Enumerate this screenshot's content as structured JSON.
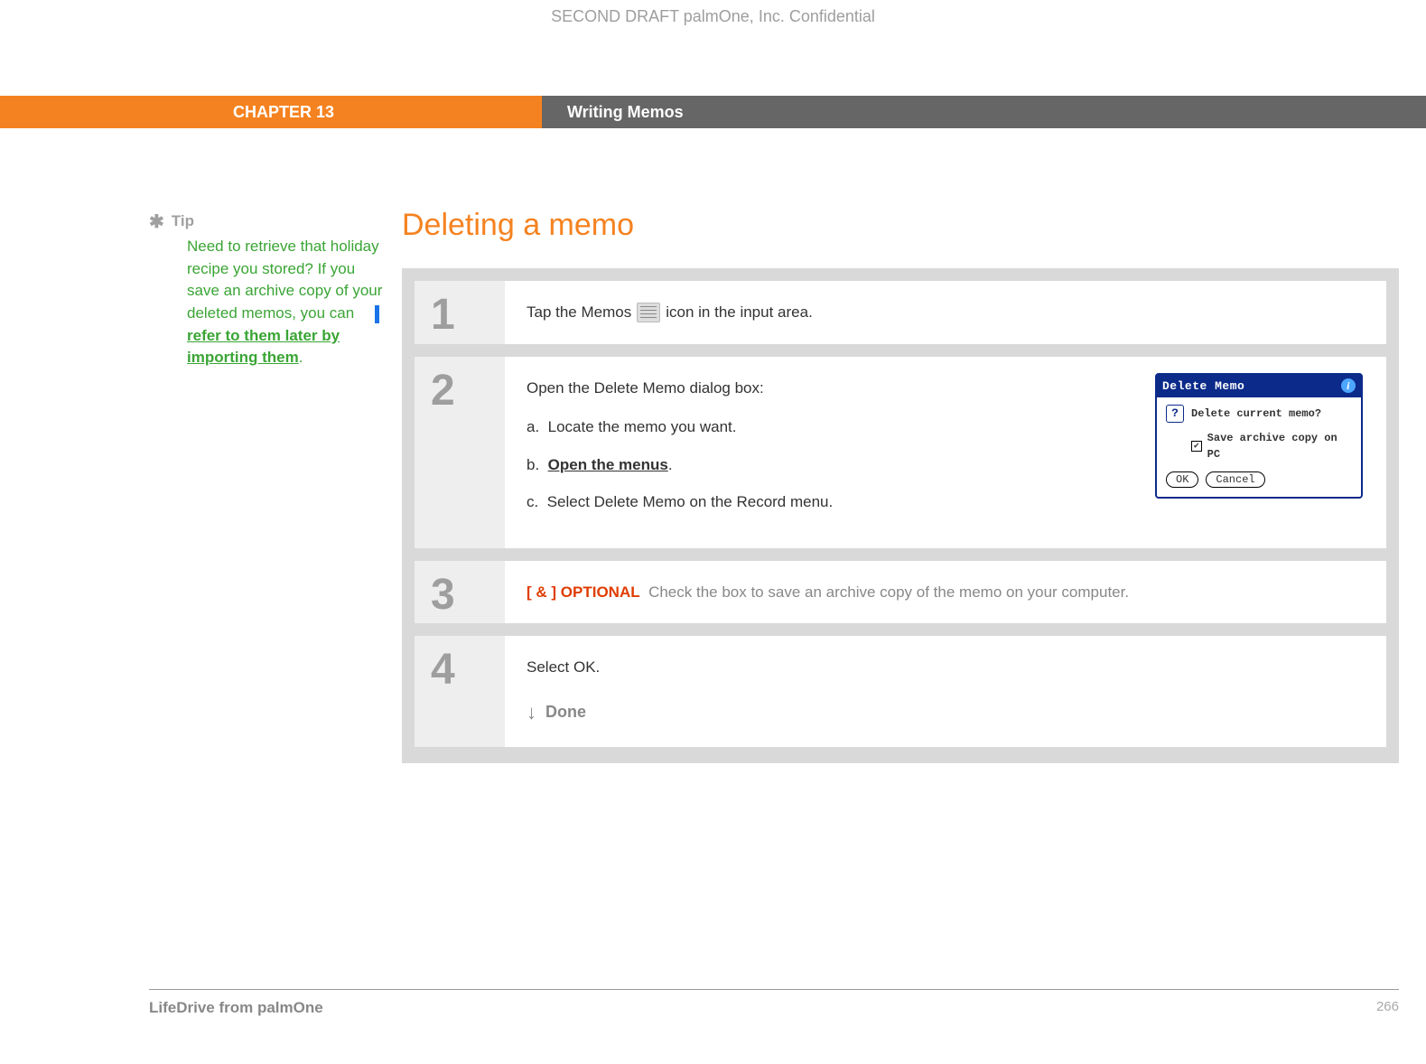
{
  "draft_line": "SECOND DRAFT palmOne, Inc.  Confidential",
  "header": {
    "chapter": "CHAPTER 13",
    "title": "Writing Memos"
  },
  "tip": {
    "label": "Tip",
    "body_before_link": "Need to retrieve that holiday recipe you stored? If you save an archive copy of your deleted memos, you can ",
    "link": "refer to them later by importing them",
    "body_after_link": "."
  },
  "main_title": "Deleting a memo",
  "steps": {
    "s1": {
      "num": "1",
      "before_icon": "Tap the Memos",
      "after_icon": "icon in the input area."
    },
    "s2": {
      "num": "2",
      "intro": "Open the Delete Memo dialog box:",
      "a_label": "a.",
      "a_text": "Locate the memo you want.",
      "b_label": "b.",
      "b_link": "Open the menus",
      "b_after": ".",
      "c_label": "c.",
      "c_text": "Select Delete Memo on the Record menu.",
      "dialog": {
        "title": "Delete Memo",
        "question": "Delete current memo?",
        "checkbox": "Save archive copy on PC",
        "ok": "OK",
        "cancel": "Cancel"
      }
    },
    "s3": {
      "num": "3",
      "tag": "[ & ]  OPTIONAL",
      "text": "Check the box to save an archive copy of the memo on your computer."
    },
    "s4": {
      "num": "4",
      "text": "Select OK.",
      "done": "Done"
    }
  },
  "footer": {
    "product": "LifeDrive from palmOne",
    "page": "266"
  }
}
